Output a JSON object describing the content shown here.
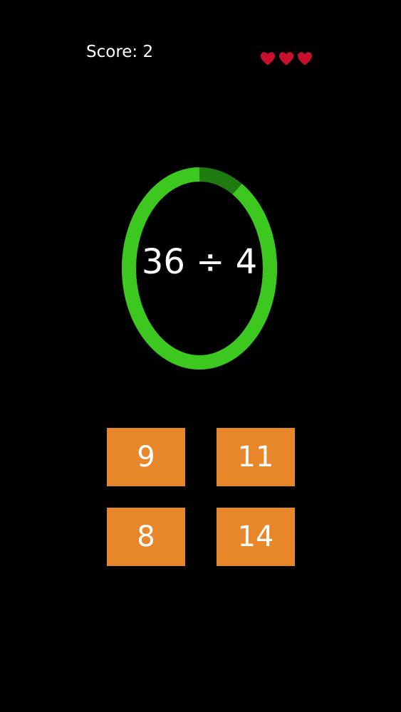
{
  "hud": {
    "score_label": "Score: 2",
    "lives": 3,
    "heart_icon": "heart-icon",
    "heart_color": "#c8102e"
  },
  "timer": {
    "remaining_fraction": 0.91,
    "ring_color": "#3cc81e",
    "elapsed_color": "#1f7a10"
  },
  "question": {
    "text": "36 ÷ 4"
  },
  "answers": [
    {
      "label": "9"
    },
    {
      "label": "11"
    },
    {
      "label": "8"
    },
    {
      "label": "14"
    }
  ],
  "colors": {
    "background": "#000000",
    "answer_button": "#e8862a",
    "text": "#ffffff"
  }
}
